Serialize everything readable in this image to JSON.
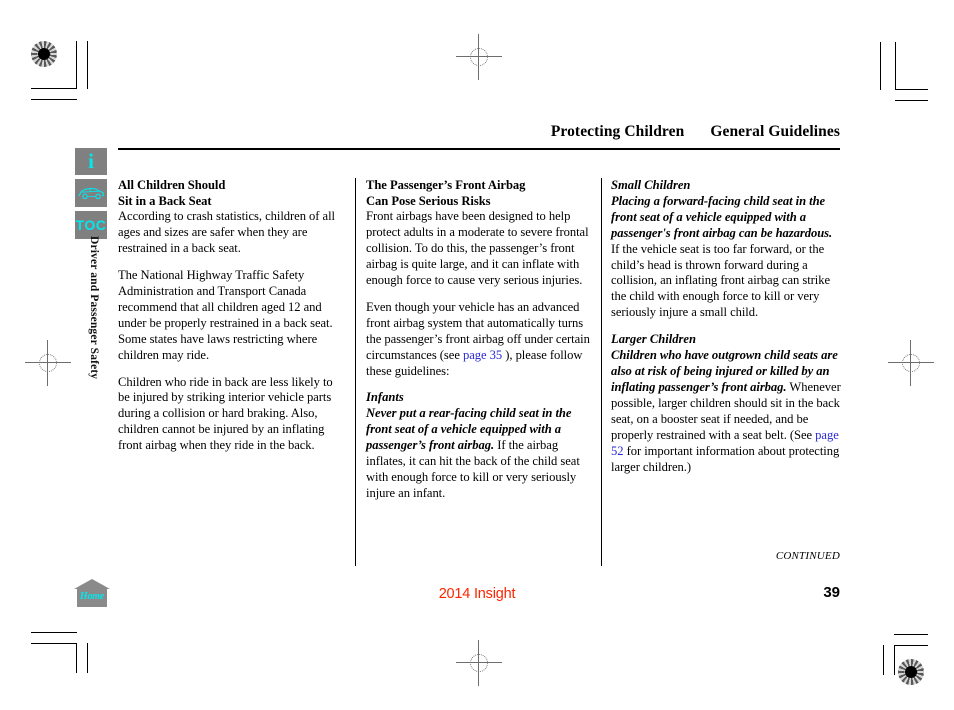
{
  "header": {
    "section_title": "Protecting Children",
    "page_title": "General Guidelines"
  },
  "sidebar": {
    "icons": [
      {
        "name": "info-icon",
        "glyph": "i",
        "label": "Information"
      },
      {
        "name": "vehicle-icon",
        "glyph": "car",
        "label": "Vehicle"
      },
      {
        "name": "toc-icon",
        "glyph": "TOC",
        "label": "Table of Contents"
      }
    ],
    "vertical_label": "Driver and Passenger Safety"
  },
  "columns": {
    "left": {
      "heading_line1": "All Children Should",
      "heading_line2": "Sit in a Back Seat",
      "paragraph1": "According to crash statistics, children of all ages and sizes are safer when they are restrained in a back seat.",
      "paragraph2": "The National Highway Traffic Safety Administration and Transport Canada recommend that all children aged 12 and under be properly restrained in a back seat. Some states have laws restricting where children may ride.",
      "paragraph3": "Children who ride in back are less likely to be injured by striking interior vehicle parts during a collision or hard braking. Also, children cannot be injured by an inflating front airbag when they ride in the back."
    },
    "middle": {
      "heading_line1": "The Passenger’s Front Airbag",
      "heading_line2": "Can Pose Serious Risks",
      "paragraph1": "Front airbags have been designed to help protect adults in a moderate to severe frontal collision. To do this, the passenger’s front airbag is quite large, and it can inflate with enough force to cause very serious injuries.",
      "paragraph2_part1": "Even though your vehicle has an advanced front airbag system that automatically turns the passenger’s front airbag off under certain circumstances (see ",
      "paragraph2_link": "page 35",
      "paragraph2_part2": " ), please follow these guidelines:",
      "subheading": "Infants",
      "warning_bold": "Never put a rear-facing child seat in the front seat of a vehicle equipped with a passenger’s front airbag.",
      "warning_rest": " If the airbag inflates, it can hit the back  of the child seat with enough force  to kill or very seriously injure an infant."
    },
    "right": {
      "subheading1": "Small Children",
      "warning1_bold": "Placing a forward-facing child seat in the front seat of a vehicle equipped with a passenger's front airbag can be hazardous.",
      "warning1_rest": " If the vehicle seat is too far forward, or the child’s head is thrown forward during a collision, an inflating front airbag can strike the child with enough force to kill or very seriously injure a small child.",
      "subheading2": "Larger Children",
      "warning2_bold": "Children who have outgrown child seats are also at risk of being injured or killed by an inflating passenger’s front airbag.",
      "warning2_rest_part1": " Whenever possible, larger children should sit in the back seat, on a booster seat if needed, and be properly restrained with a seat belt. (See ",
      "warning2_link": "page 52",
      "warning2_rest_part2": " for important information about protecting larger children.)"
    }
  },
  "footer": {
    "continued": "CONTINUED",
    "model": "2014 Insight",
    "page_number": "39",
    "home_label": "Home"
  },
  "colors": {
    "link": "#2a2ad6",
    "model_red": "#ff2400",
    "icon_cyan": "#00e8ee",
    "icon_gray": "#808080"
  }
}
